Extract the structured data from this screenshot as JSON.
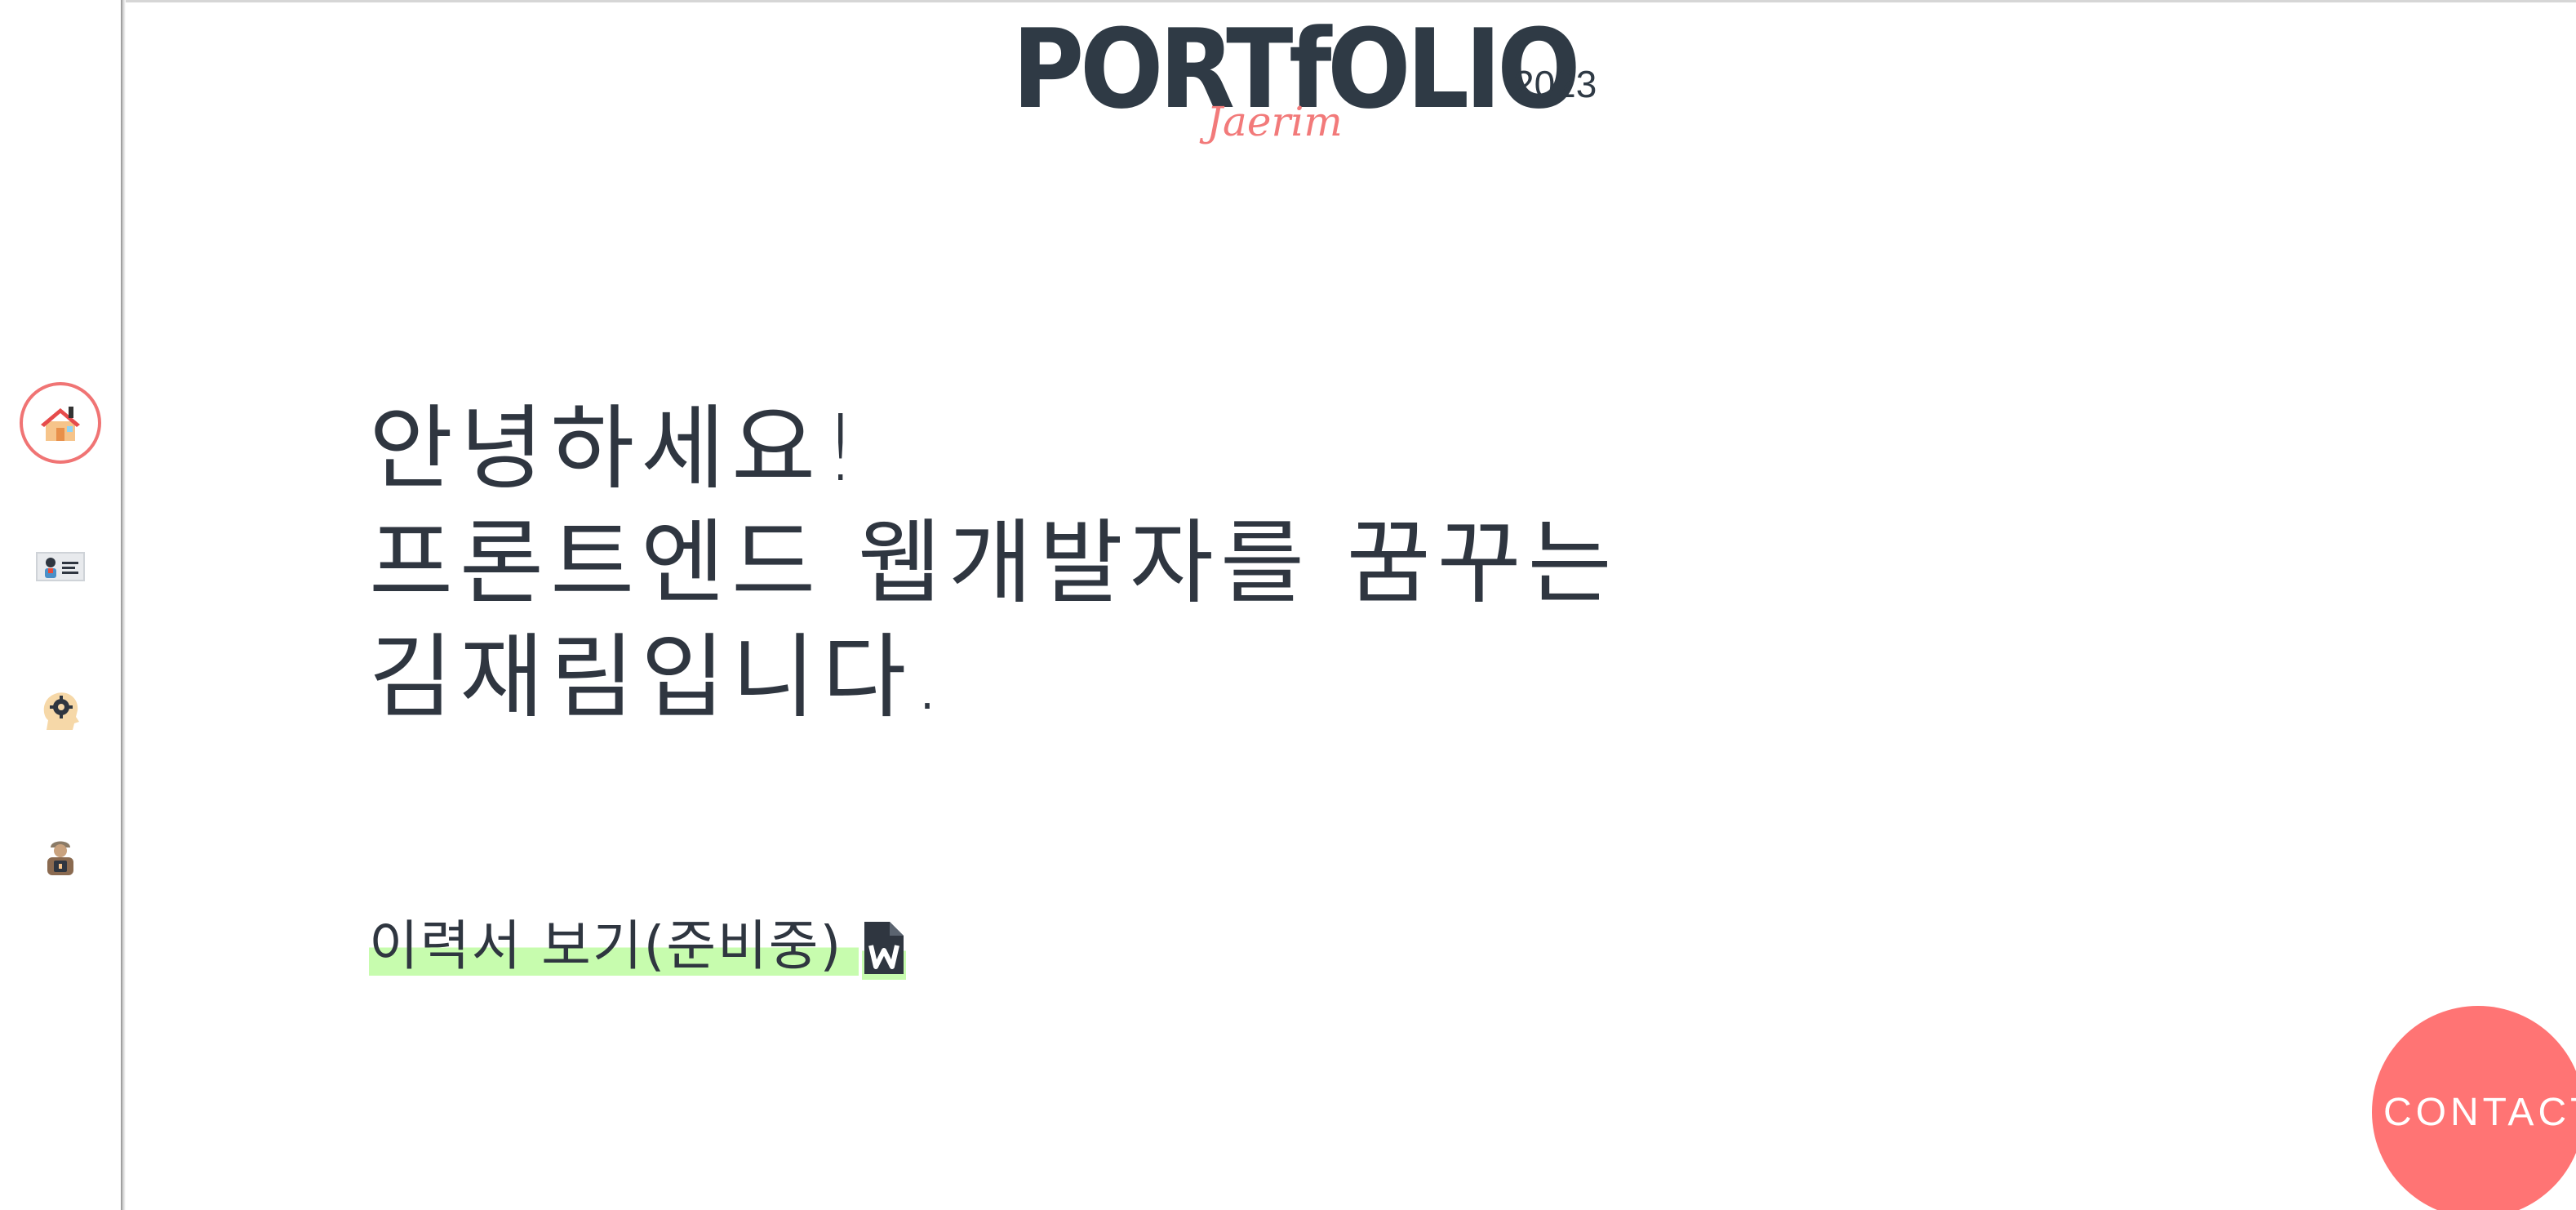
{
  "header": {
    "logo_text": "PORTfOLIO",
    "year": "2023",
    "signature": "Jaerim"
  },
  "sidebar": {
    "items": [
      {
        "name": "home",
        "icon": "home-icon",
        "active": true
      },
      {
        "name": "profile",
        "icon": "id-card-icon",
        "active": false
      },
      {
        "name": "skills",
        "icon": "brain-gear-icon",
        "active": false
      },
      {
        "name": "projects",
        "icon": "worker-icon",
        "active": false
      }
    ]
  },
  "intro": {
    "lines": [
      "안녕하세요!",
      "프론트엔드 웹개발자를 꿈꾸는",
      "김재림입니다."
    ]
  },
  "resume": {
    "label": "이력서 보기(준비중)",
    "icon": "word-file-icon"
  },
  "contact": {
    "label": "CONTACT"
  },
  "colors": {
    "accent": "#ff7474",
    "text": "#2f3640",
    "highlight": "#c7fcae"
  }
}
